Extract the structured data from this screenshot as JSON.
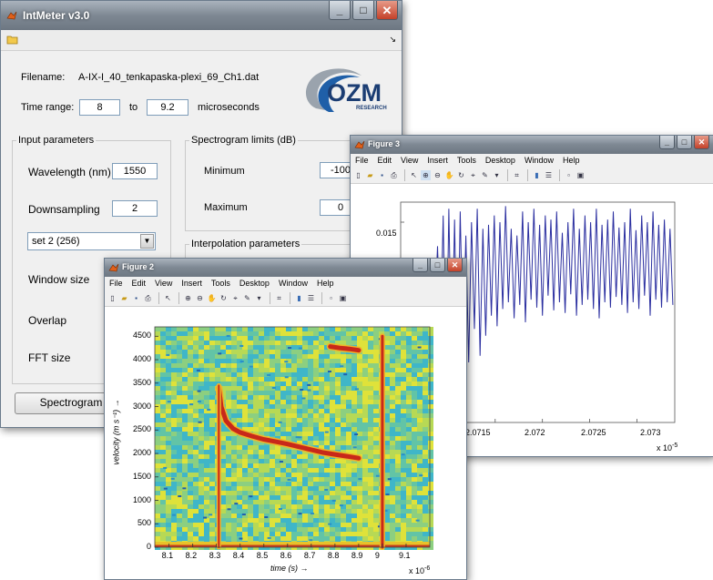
{
  "main": {
    "title": "IntMeter v3.0",
    "filename_label": "Filename:",
    "filename_value": "A-IX-I_40_tenkapaska-plexi_69_Ch1.dat",
    "time_range_label": "Time range:",
    "time_from": "8",
    "time_to_label": "to",
    "time_to": "9.2",
    "time_unit": "microseconds",
    "logo_text": "OZM",
    "logo_sub": "RESEARCH",
    "input_params": {
      "legend": "Input parameters",
      "wavelength_label": "Wavelength (nm)",
      "wavelength_value": "1550",
      "downsampling_label": "Downsampling",
      "downsampling_value": "2",
      "set_selected": "set 2 (256)",
      "window_size_label": "Window size",
      "overlap_label": "Overlap",
      "fft_size_label": "FFT size"
    },
    "spectrogram_limits": {
      "legend": "Spectrogram limits (dB)",
      "minimum_label": "Minimum",
      "minimum_value": "-100",
      "maximum_label": "Maximum",
      "maximum_value": "0"
    },
    "interp_legend": "Interpolation parameters",
    "spectrogram_button": "Spectrogram"
  },
  "menu": [
    "File",
    "Edit",
    "View",
    "Insert",
    "Tools",
    "Desktop",
    "Window",
    "Help"
  ],
  "fig3": {
    "title": "Figure 3",
    "y_ticks": [
      "0.015"
    ],
    "x_ticks": [
      "2.0715",
      "2.072",
      "2.0725",
      "2.073"
    ],
    "x_multiplier": "x 10",
    "x_multiplier_exp": "-5",
    "line_color": "#2b2fa0"
  },
  "fig2": {
    "title": "Figure 2",
    "y_ticks": [
      "0",
      "500",
      "1000",
      "1500",
      "2000",
      "2500",
      "3000",
      "3500",
      "4000",
      "4500"
    ],
    "x_ticks": [
      "8.1",
      "8.2",
      "8.3",
      "8.4",
      "8.5",
      "8.6",
      "8.7",
      "8.8",
      "8.9",
      "9",
      "9.1"
    ],
    "xlabel": "time (s) →",
    "ylabel": "velocity (m s⁻¹) →",
    "x_multiplier": "x 10",
    "x_multiplier_exp": "-6"
  },
  "chart_data": [
    {
      "type": "line",
      "title": "",
      "xlabel": "",
      "ylabel": "",
      "x_scale_note": "x 10^-5",
      "xlim": [
        2.0705,
        2.0734
      ],
      "ylim": [
        0.0,
        0.0165
      ],
      "series": [
        {
          "x": [
            2.0705,
            2.07053,
            2.07056,
            2.07059,
            2.07062,
            2.07065,
            2.07068,
            2.07071,
            2.07074,
            2.07077,
            2.0708,
            2.07083,
            2.07086,
            2.07089,
            2.07092,
            2.07095,
            2.07098,
            2.07101,
            2.07104,
            2.07107,
            2.0711,
            2.07113,
            2.07116,
            2.07119,
            2.07122,
            2.07125,
            2.07128,
            2.07131,
            2.07134,
            2.07137,
            2.0714,
            2.07143,
            2.07146,
            2.07149,
            2.07152,
            2.07155,
            2.07158,
            2.07161,
            2.07164,
            2.07167,
            2.0717,
            2.07173,
            2.07176,
            2.07179,
            2.07182,
            2.07185,
            2.07188,
            2.07191,
            2.07194,
            2.07197,
            2.072,
            2.07203,
            2.07206,
            2.07209,
            2.07212,
            2.07215,
            2.07218,
            2.07221,
            2.07224,
            2.07227,
            2.0723,
            2.07233,
            2.07236,
            2.07239,
            2.07242,
            2.07245,
            2.07248,
            2.07251,
            2.07254,
            2.07257,
            2.0726,
            2.07263,
            2.07266,
            2.07269,
            2.07272,
            2.07275,
            2.07278,
            2.07281,
            2.07284,
            2.07287,
            2.0729,
            2.07293,
            2.07296,
            2.07299,
            2.07302,
            2.07305,
            2.07308,
            2.07311,
            2.07314,
            2.07317,
            2.0732,
            2.07323,
            2.07326,
            2.07329,
            2.07332,
            2.07335,
            2.07338
          ],
          "y": [
            0.0005,
            0.0035,
            0.0012,
            0.004,
            0.0008,
            0.0048,
            0.0015,
            0.0042,
            0.001,
            0.0052,
            0.0005,
            0.01,
            0.008,
            0.0132,
            0.006,
            0.0155,
            0.002,
            0.016,
            0.004,
            0.0152,
            0.003,
            0.0158,
            0.0055,
            0.014,
            0.0045,
            0.015,
            0.007,
            0.016,
            0.005,
            0.0145,
            0.0065,
            0.0148,
            0.008,
            0.0155,
            0.0072,
            0.015,
            0.0085,
            0.0162,
            0.009,
            0.0145,
            0.0078,
            0.014,
            0.0088,
            0.0158,
            0.0075,
            0.015,
            0.0092,
            0.016,
            0.0086,
            0.0148,
            0.008,
            0.0155,
            0.0095,
            0.0152,
            0.0084,
            0.0158,
            0.009,
            0.0142,
            0.0082,
            0.015,
            0.0096,
            0.016,
            0.008,
            0.0145,
            0.0088,
            0.0155,
            0.0092,
            0.015,
            0.0085,
            0.016,
            0.0078,
            0.0148,
            0.009,
            0.0152,
            0.0086,
            0.0158,
            0.0094,
            0.0146,
            0.0088,
            0.015,
            0.0082,
            0.016,
            0.009,
            0.0144,
            0.0085,
            0.0155,
            0.0095,
            0.015,
            0.008,
            0.0158,
            0.0092,
            0.0148,
            0.0086,
            0.0152,
            0.009,
            0.0145,
            0.0088
          ]
        }
      ]
    },
    {
      "type": "heatmap",
      "title": "",
      "xlabel": "time (s) →",
      "ylabel": "velocity (m s⁻¹) →",
      "x_scale_note": "x 10^-6",
      "xlim": [
        8.04,
        9.2
      ],
      "ylim": [
        0,
        4700
      ],
      "features": [
        {
          "name": "",
          "x": [
            8.31,
            8.32,
            8.34,
            8.37,
            8.4,
            8.45,
            8.5,
            8.55,
            8.6,
            8.65,
            8.7,
            8.75,
            8.8,
            8.85,
            8.9
          ],
          "y": [
            3400,
            3000,
            2700,
            2530,
            2450,
            2370,
            2300,
            2250,
            2200,
            2140,
            2080,
            2020,
            1980,
            1940,
            1900
          ]
        },
        {
          "name": "",
          "x": [
            8.78,
            8.82,
            8.86,
            8.9
          ],
          "y": [
            4280,
            4250,
            4230,
            4200
          ]
        },
        {
          "name": "",
          "x": [
            8.31,
            8.31
          ],
          "y": [
            0,
            3450
          ]
        },
        {
          "name": "",
          "x": [
            9.0,
            9.0
          ],
          "y": [
            0,
            4500
          ]
        }
      ]
    }
  ]
}
